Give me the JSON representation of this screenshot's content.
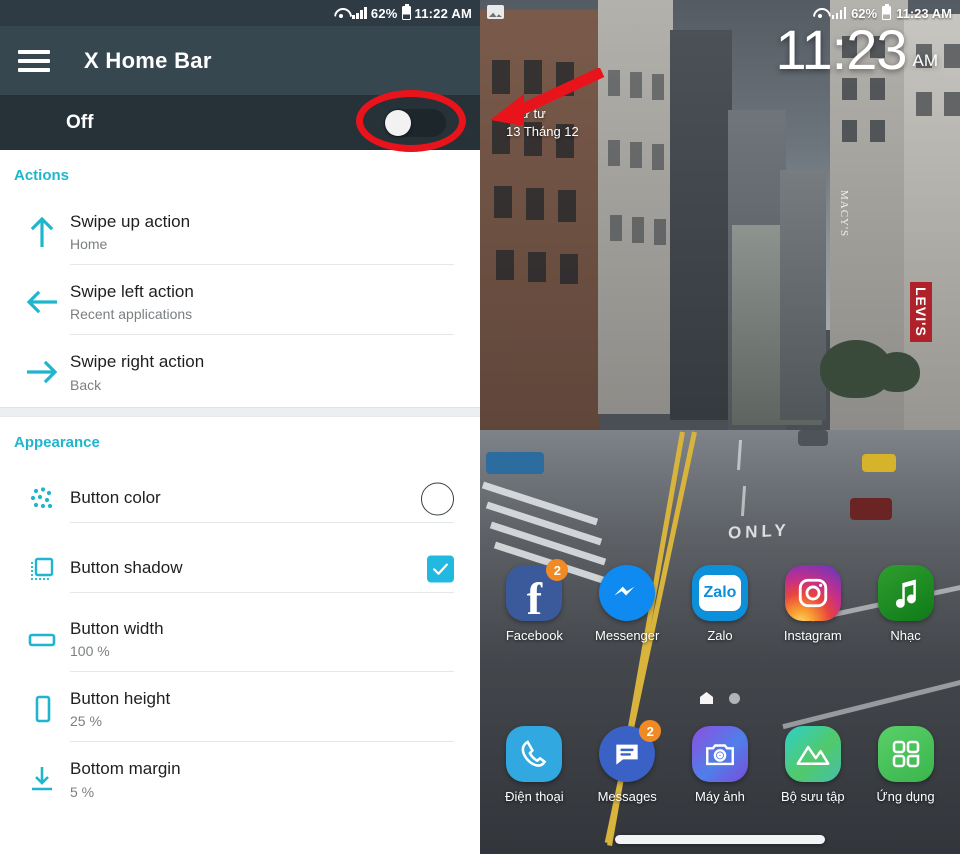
{
  "left_phone": {
    "status_bar": {
      "battery_percent": "62%",
      "time": "11:22 AM",
      "wifi_icon": "wifi-icon",
      "signal_icon": "signal-icon",
      "battery_icon": "battery-icon"
    },
    "app_bar": {
      "menu_icon": "hamburger-menu-icon",
      "title": "X Home Bar"
    },
    "master_switch": {
      "label": "Off",
      "state": "off",
      "annotation": "red-ellipse-highlight"
    },
    "sections": [
      {
        "title": "Actions",
        "rows": [
          {
            "icon": "arrow-up-icon",
            "title": "Swipe up action",
            "value": "Home"
          },
          {
            "icon": "arrow-left-icon",
            "title": "Swipe left action",
            "value": "Recent applications"
          },
          {
            "icon": "arrow-right-icon",
            "title": "Swipe right action",
            "value": "Back"
          }
        ]
      },
      {
        "title": "Appearance",
        "rows": [
          {
            "icon": "color-palette-icon",
            "title": "Button color",
            "value": "",
            "trailing": "color-swatch-white"
          },
          {
            "icon": "shadow-square-icon",
            "title": "Button shadow",
            "value": "",
            "trailing": "checkbox-checked"
          },
          {
            "icon": "width-rect-icon",
            "title": "Button width",
            "value": "100 %"
          },
          {
            "icon": "height-rect-icon",
            "title": "Button height",
            "value": "25 %"
          },
          {
            "icon": "arrow-down-to-line-icon",
            "title": "Bottom margin",
            "value": "5 %"
          }
        ]
      }
    ],
    "colors": {
      "accent": "#1fb6cd",
      "appbar": "#37474f",
      "master_row": "#263238",
      "annotation": "#e8131b"
    }
  },
  "right_phone": {
    "status_bar": {
      "battery_percent": "62%",
      "time": "11:23 AM",
      "gallery_icon": "gallery-notification-icon"
    },
    "date_widget": {
      "weekday": "Thứ tư",
      "date": "13 Tháng 12",
      "annotation": "red-arrow-pointing-at-date"
    },
    "clock_widget": {
      "time": "11:23",
      "meridiem": "AM"
    },
    "wallpaper": {
      "description": "city-street-photo",
      "sign_macys": "MACY'S",
      "sign_levi": "LEVI'S",
      "road_marking": "ONLY"
    },
    "app_rows": [
      [
        {
          "label": "Facebook",
          "icon": "facebook-icon",
          "badge": "2"
        },
        {
          "label": "Messenger",
          "icon": "messenger-icon",
          "badge": ""
        },
        {
          "label": "Zalo",
          "icon": "zalo-icon",
          "badge": ""
        },
        {
          "label": "Instagram",
          "icon": "instagram-icon",
          "badge": ""
        },
        {
          "label": "Nhạc",
          "icon": "music-icon",
          "badge": ""
        }
      ],
      [
        {
          "label": "Điện thoại",
          "icon": "phone-icon",
          "badge": ""
        },
        {
          "label": "Messages",
          "icon": "messages-icon",
          "badge": "2"
        },
        {
          "label": "Máy ảnh",
          "icon": "camera-icon",
          "badge": ""
        },
        {
          "label": "Bộ sưu tập",
          "icon": "gallery-icon",
          "badge": ""
        },
        {
          "label": "Ứng dụng",
          "icon": "apps-grid-icon",
          "badge": ""
        }
      ]
    ],
    "page_indicator": {
      "home_icon": "home-page-icon",
      "dots": 1
    },
    "home_bar": "x-home-bar-gesture-pill",
    "zalo_text": "Zalo"
  }
}
